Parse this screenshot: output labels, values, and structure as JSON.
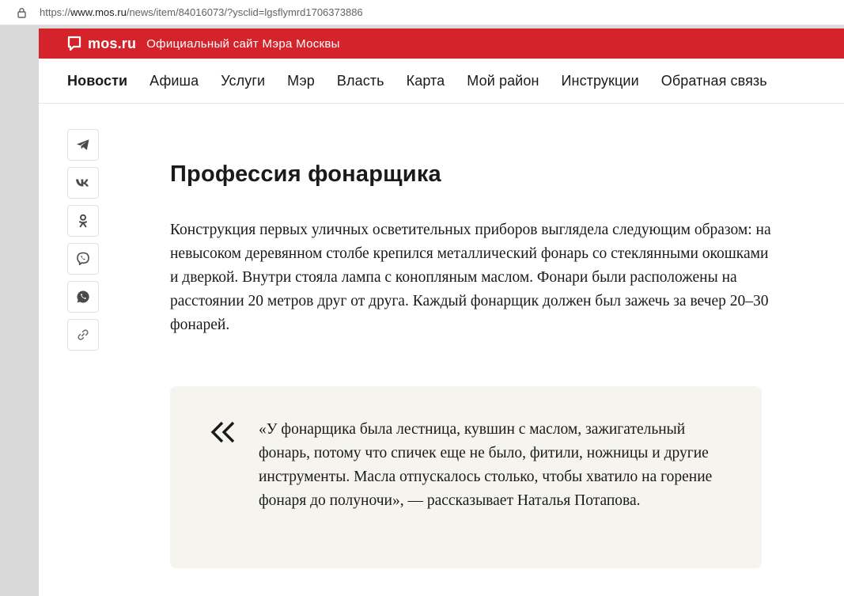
{
  "browser": {
    "url_prefix": "https://",
    "url_host": "www.mos.ru",
    "url_path": "/news/item/84016073/?ysclid=lgsflymrd1706373886"
  },
  "header": {
    "brand": "mos.ru",
    "tagline": "Официальный сайт Мэра Москвы",
    "accent_color": "#d5232b"
  },
  "nav": {
    "items": [
      {
        "label": "Новости",
        "active": true
      },
      {
        "label": "Афиша"
      },
      {
        "label": "Услуги"
      },
      {
        "label": "Мэр"
      },
      {
        "label": "Власть"
      },
      {
        "label": "Карта"
      },
      {
        "label": "Мой район"
      },
      {
        "label": "Инструкции"
      },
      {
        "label": "Обратная связь"
      }
    ]
  },
  "share": {
    "icons": [
      "telegram-icon",
      "vk-icon",
      "odnoklassniki-icon",
      "viber-icon",
      "whatsapp-icon",
      "link-icon"
    ]
  },
  "article": {
    "title": "Профессия фонарщика",
    "body": "Конструкция первых уличных осветительных приборов выглядела следующим образом: на невысоком деревянном столбе крепился металлический фонарь со стеклянными окошками и дверкой. Внутри стояла лампа с конопляным маслом. Фонари были расположены на расстоянии 20 метров друг от друга. Каждый фонарщик должен был зажечь за вечер 20–30 фонарей.",
    "quote": "«У фонарщика была лестница, кувшин с маслом, зажигательный фонарь, потому что спичек еще не было, фитили, ножницы и другие инструменты. Масла отпускалось столько, чтобы хватило на горение фонаря до полуночи», — рассказывает Наталья Потапова."
  }
}
